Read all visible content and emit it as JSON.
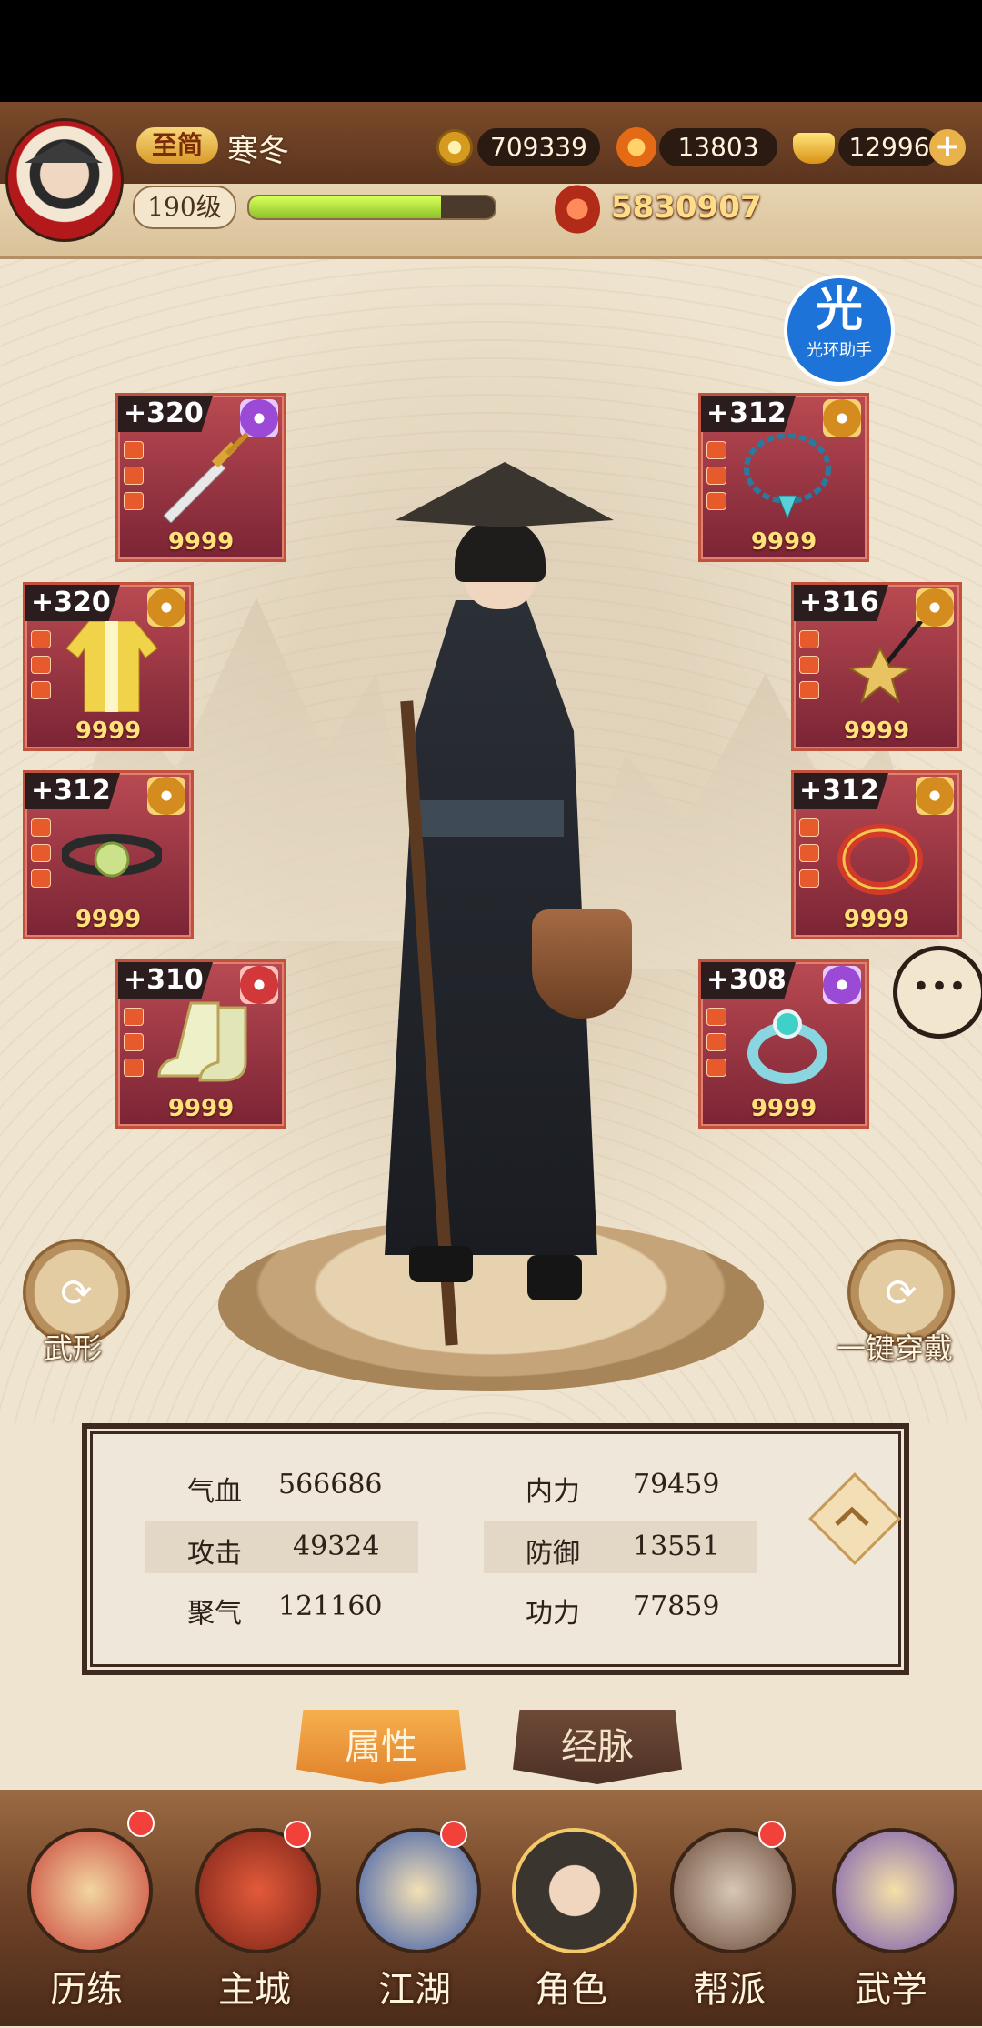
{
  "header": {
    "vip_label": "至简",
    "player_name": "寒冬",
    "level": "190级",
    "exp_progress": 0.78,
    "copper": "709339",
    "leaf_currency": "13803",
    "gold_ingot": "12996",
    "combat_power": "5830907"
  },
  "assistant": {
    "icon_text": "光",
    "label": "光环助手"
  },
  "equipment": {
    "left": [
      {
        "name": "sword",
        "enhance": "+320",
        "grade": "purple",
        "count": "9999"
      },
      {
        "name": "robe",
        "enhance": "+320",
        "grade": "gold",
        "count": "9999"
      },
      {
        "name": "belt",
        "enhance": "+312",
        "grade": "gold",
        "count": "9999"
      },
      {
        "name": "boots",
        "enhance": "+310",
        "grade": "red",
        "count": "9999"
      }
    ],
    "right": [
      {
        "name": "necklace",
        "enhance": "+312",
        "grade": "gold",
        "count": "9999"
      },
      {
        "name": "amulet",
        "enhance": "+316",
        "grade": "gold",
        "count": "9999"
      },
      {
        "name": "bracelet",
        "enhance": "+312",
        "grade": "gold",
        "count": "9999"
      },
      {
        "name": "ring",
        "enhance": "+308",
        "grade": "purple",
        "count": "9999"
      }
    ]
  },
  "buttons": {
    "appearance": "武形",
    "one_click_equip": "一键穿戴"
  },
  "stats": {
    "hp_label": "气血",
    "hp_value": "566686",
    "inner_label": "内力",
    "inner_value": "79459",
    "attack_label": "攻击",
    "attack_value": "49324",
    "defense_label": "防御",
    "defense_value": "13551",
    "focus_label": "聚气",
    "focus_value": "121160",
    "skill_label": "功力",
    "skill_value": "77859"
  },
  "tabs": {
    "attributes": "属性",
    "meridians": "经脉"
  },
  "nav": [
    {
      "label": "历练",
      "badge": true
    },
    {
      "label": "主城",
      "badge": true
    },
    {
      "label": "江湖",
      "badge": true
    },
    {
      "label": "角色",
      "badge": false
    },
    {
      "label": "帮派",
      "badge": true
    },
    {
      "label": "武学",
      "badge": false
    }
  ],
  "colors": {
    "slot_red": "#b94a52",
    "exp_green": "#8fc12a",
    "tab_active": "#e0812a",
    "badge_red": "#f2403a"
  }
}
